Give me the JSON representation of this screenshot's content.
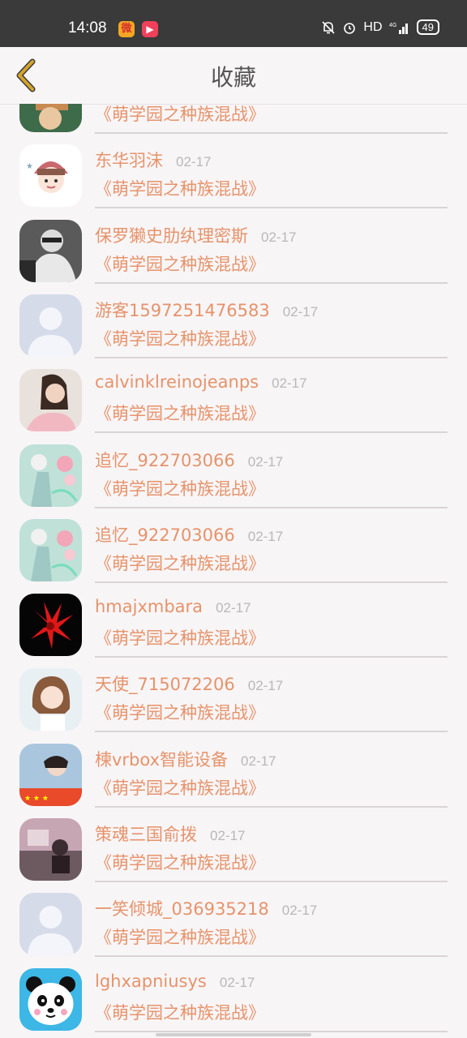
{
  "status": {
    "time": "14:08",
    "network": "HD",
    "battery": "49"
  },
  "header": {
    "title": "收藏"
  },
  "items": [
    {
      "username": "",
      "date": "",
      "game": "《萌学园之种族混战》",
      "avatar": "photo-green"
    },
    {
      "username": "东华羽沫",
      "date": "02-17",
      "game": "《萌学园之种族混战》",
      "avatar": "cartoon-girl"
    },
    {
      "username": "保罗獭史肋纨理密斯",
      "date": "02-17",
      "game": "《萌学园之种族混战》",
      "avatar": "photo-bw"
    },
    {
      "username": "游客1597251476583",
      "date": "02-17",
      "game": "《萌学园之种族混战》",
      "avatar": "default-user"
    },
    {
      "username": "calvinklreinojeanps",
      "date": "02-17",
      "game": "《萌学园之种族混战》",
      "avatar": "photo-portrait"
    },
    {
      "username": "追忆_922703066",
      "date": "02-17",
      "game": "《萌学园之种族混战》",
      "avatar": "anime-flower"
    },
    {
      "username": "追忆_922703066",
      "date": "02-17",
      "game": "《萌学园之种族混战》",
      "avatar": "anime-flower"
    },
    {
      "username": "hmajxmbara",
      "date": "02-17",
      "game": "《萌学园之种族混战》",
      "avatar": "red-flower"
    },
    {
      "username": "天使_715072206",
      "date": "02-17",
      "game": "《萌学园之种族混战》",
      "avatar": "photo-girl"
    },
    {
      "username": "楝vrbox智能设备",
      "date": "02-17",
      "game": "《萌学园之种族混战》",
      "avatar": "photo-outdoor"
    },
    {
      "username": "策魂三国俞拨",
      "date": "02-17",
      "game": "《萌学园之种族混战》",
      "avatar": "photo-room"
    },
    {
      "username": "一笑倾城_036935218",
      "date": "02-17",
      "game": "《萌学园之种族混战》",
      "avatar": "default-user"
    },
    {
      "username": "lghxapniusys",
      "date": "02-17",
      "game": "《萌学园之种族混战》",
      "avatar": "panda"
    }
  ],
  "colors": {
    "accent": "#e6936a",
    "back_arrow": "#d4a32a"
  }
}
